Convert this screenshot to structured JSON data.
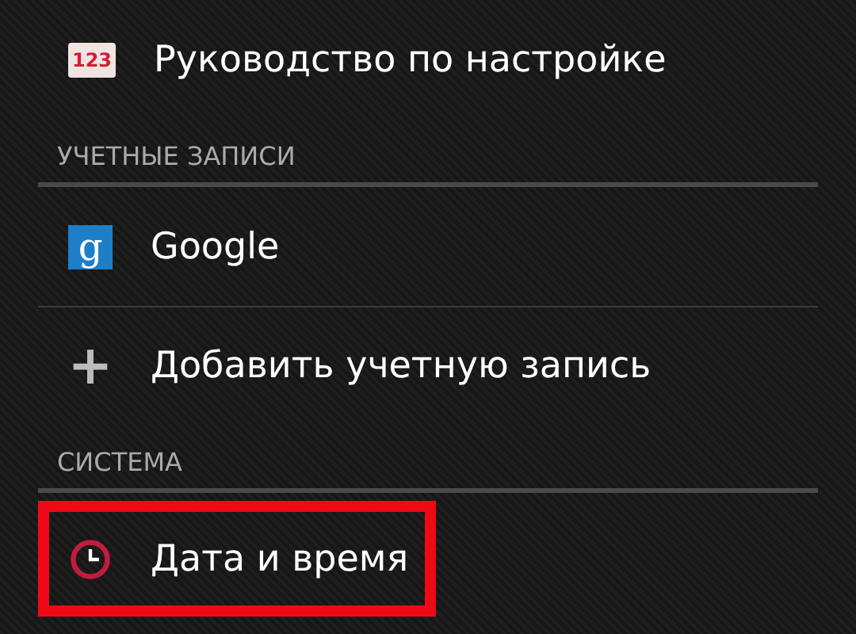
{
  "sections": [
    {
      "items": [
        {
          "kind": "guide",
          "icon_text": "123",
          "label": "Руководство по настройке",
          "highlighted": false
        }
      ]
    },
    {
      "header": "УЧЕТНЫЕ ЗАПИСИ",
      "items": [
        {
          "kind": "account",
          "icon_text": "g",
          "label": "Google",
          "highlighted": false
        },
        {
          "kind": "add",
          "icon_text": "+",
          "label": "Добавить учетную запись",
          "highlighted": false
        }
      ]
    },
    {
      "header": "СИСТЕМА",
      "items": [
        {
          "kind": "clock",
          "label": "Дата и время",
          "highlighted": true
        }
      ]
    }
  ]
}
